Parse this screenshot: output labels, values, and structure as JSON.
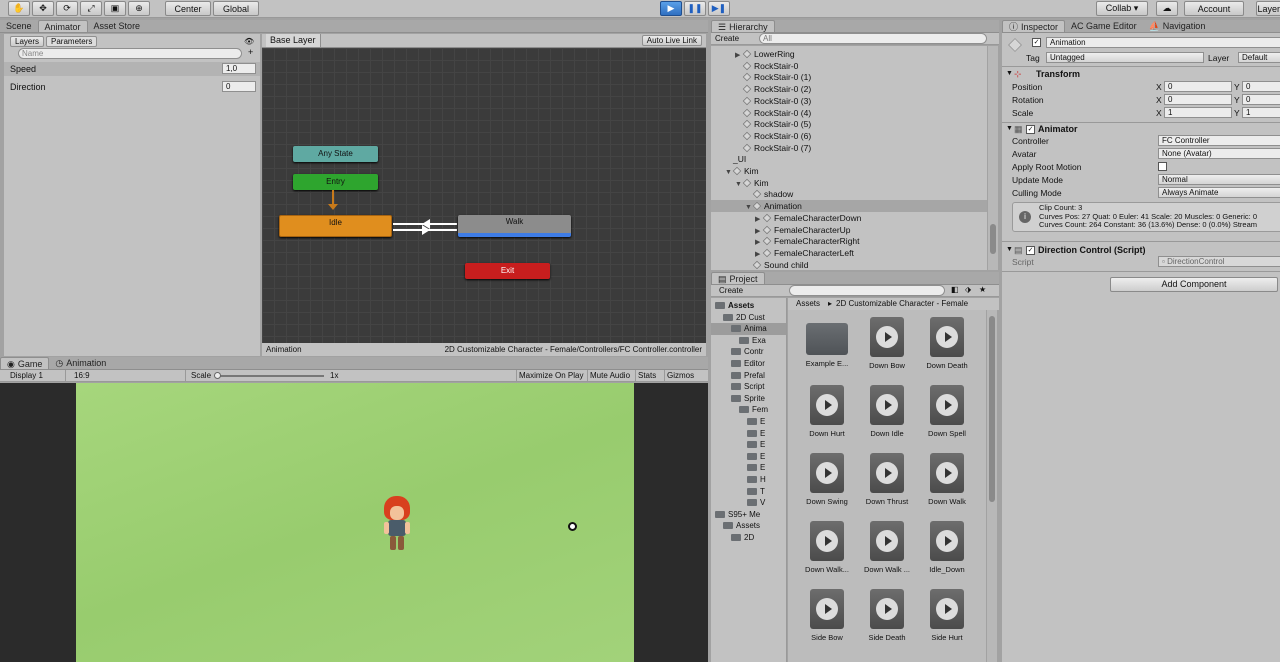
{
  "toolbar": {
    "pivot": "Center",
    "space": "Global",
    "collab": "Collab ▾",
    "account": "Account",
    "layers": "Layers"
  },
  "animator": {
    "tabs": [
      "Scene",
      "Animator",
      "Asset Store"
    ],
    "left_tabs": [
      "Layers",
      "Parameters"
    ],
    "search_placeholder": "Name",
    "params": [
      {
        "name": "Speed",
        "value": "1,0"
      },
      {
        "name": "Direction",
        "value": "0"
      }
    ],
    "layer_name": "Base Layer",
    "auto_live_link": "Auto Live Link",
    "states": {
      "any": "Any State",
      "entry": "Entry",
      "idle": "Idle",
      "walk": "Walk",
      "exit": "Exit"
    },
    "status_left": "Animation",
    "status_right": "2D Customizable Character - Female/Controllers/FC Controller.controller"
  },
  "game": {
    "tabs": [
      "Game",
      "Animation"
    ],
    "display": "Display 1",
    "aspect": "16:9",
    "scale_label": "Scale",
    "scale_value": "1x",
    "buttons": [
      "Maximize On Play",
      "Mute Audio",
      "Stats",
      "Gizmos"
    ]
  },
  "hierarchy": {
    "tab": "Hierarchy",
    "create": "Create",
    "search_placeholder": "All",
    "items": [
      {
        "label": "LowerRing",
        "indent": 1,
        "arrow": "▶"
      },
      {
        "label": "RockStair-0",
        "indent": 1,
        "arrow": ""
      },
      {
        "label": "RockStair-0 (1)",
        "indent": 1,
        "arrow": ""
      },
      {
        "label": "RockStair-0 (2)",
        "indent": 1,
        "arrow": ""
      },
      {
        "label": "RockStair-0 (3)",
        "indent": 1,
        "arrow": ""
      },
      {
        "label": "RockStair-0 (4)",
        "indent": 1,
        "arrow": ""
      },
      {
        "label": "RockStair-0 (5)",
        "indent": 1,
        "arrow": ""
      },
      {
        "label": "RockStair-0 (6)",
        "indent": 1,
        "arrow": ""
      },
      {
        "label": "RockStair-0 (7)",
        "indent": 1,
        "arrow": ""
      },
      {
        "label": "_UI",
        "indent": 0,
        "arrow": ""
      },
      {
        "label": "Kim",
        "indent": 0,
        "arrow": "▼"
      },
      {
        "label": "Kim",
        "indent": 1,
        "arrow": "▼"
      },
      {
        "label": "shadow",
        "indent": 2,
        "arrow": ""
      },
      {
        "label": "Animation",
        "indent": 2,
        "arrow": "▼",
        "selected": true
      },
      {
        "label": "FemaleCharacterDown",
        "indent": 3,
        "arrow": "▶"
      },
      {
        "label": "FemaleCharacterUp",
        "indent": 3,
        "arrow": "▶"
      },
      {
        "label": "FemaleCharacterRight",
        "indent": 3,
        "arrow": "▶"
      },
      {
        "label": "FemaleCharacterLeft",
        "indent": 3,
        "arrow": "▶"
      },
      {
        "label": "Sound child",
        "indent": 2,
        "arrow": ""
      }
    ]
  },
  "project": {
    "tab": "Project",
    "create": "Create",
    "breadcrumb": [
      "Assets",
      "2D Customizable Character - Female"
    ],
    "tree": [
      "Assets",
      "2D Cust",
      "Anima",
      "Exa",
      "Contr",
      "Editor",
      "Prefal",
      "Script",
      "Sprite",
      "Fem",
      "E",
      "E",
      "E",
      "E",
      "E",
      "H",
      "T",
      "V",
      "S95+ Me",
      "Assets",
      "2D"
    ],
    "assets": [
      "Example E...",
      "Down Bow",
      "Down Death",
      "Down Hurt",
      "Down Idle",
      "Down Spell",
      "Down Swing",
      "Down Thrust",
      "Down Walk",
      "Down Walk...",
      "Down Walk ...",
      "Idle_Down",
      "Side Bow",
      "Side Death",
      "Side Hurt"
    ]
  },
  "inspector": {
    "tabs": [
      "Inspector",
      "AC Game Editor",
      "Navigation"
    ],
    "object_name": "Animation",
    "tag_label": "Tag",
    "tag": "Untagged",
    "layer_label": "Layer",
    "layer": "Default",
    "transform": {
      "title": "Transform",
      "rows": [
        {
          "label": "Position",
          "x": "0",
          "y": "0"
        },
        {
          "label": "Rotation",
          "x": "0",
          "y": "0"
        },
        {
          "label": "Scale",
          "x": "1",
          "y": "1"
        }
      ]
    },
    "animator": {
      "title": "Animator",
      "rows": [
        {
          "label": "Controller",
          "value": "FC Controller"
        },
        {
          "label": "Avatar",
          "value": "None (Avatar)"
        },
        {
          "label": "Apply Root Motion",
          "value": ""
        },
        {
          "label": "Update Mode",
          "value": "Normal"
        },
        {
          "label": "Culling Mode",
          "value": "Always Animate"
        }
      ],
      "info": [
        "Clip Count: 3",
        "Curves Pos: 27 Quat: 0 Euler: 41 Scale: 20 Muscles: 0 Generic: 0",
        "Curves Count: 264 Constant: 36 (13.6%) Dense: 0 (0.0%) Stream"
      ]
    },
    "script": {
      "title": "Direction Control (Script)",
      "label": "Script",
      "value": "DirectionControl"
    },
    "add_component": "Add Component"
  },
  "colors": {
    "any_state": "#5fa9a2",
    "entry": "#2ea52e",
    "idle": "#e08e1e",
    "walk": "#8c8c8c",
    "exit": "#c81e1e",
    "selection": "#3e7ce6"
  }
}
